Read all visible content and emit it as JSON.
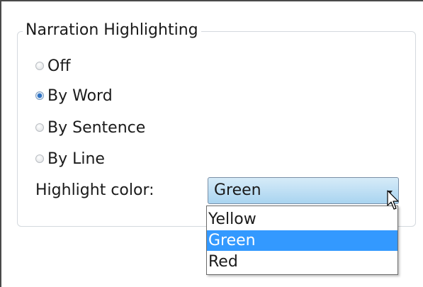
{
  "group": {
    "title": "Narration Highlighting"
  },
  "radios": [
    {
      "label": "Off",
      "checked": false
    },
    {
      "label": "By Word",
      "checked": true
    },
    {
      "label": "By Sentence",
      "checked": false
    },
    {
      "label": "By Line",
      "checked": false
    }
  ],
  "highlight": {
    "label": "Highlight color:",
    "selected": "Green",
    "options": [
      "Yellow",
      "Green",
      "Red"
    ]
  }
}
